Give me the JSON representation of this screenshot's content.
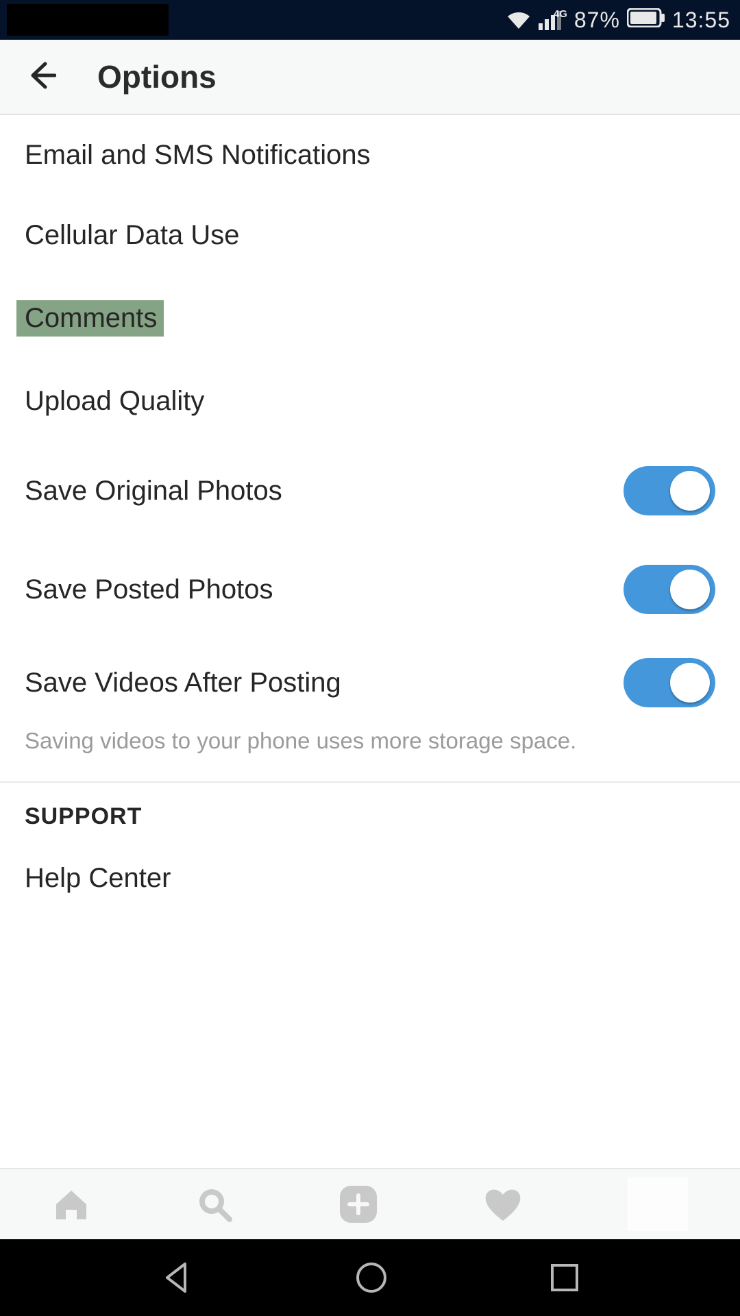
{
  "status": {
    "network_label": "4G",
    "battery_pct": "87%",
    "time": "13:55"
  },
  "header": {
    "title": "Options"
  },
  "options": {
    "email_sms": "Email and SMS Notifications",
    "cellular": "Cellular Data Use",
    "comments": "Comments",
    "upload_quality": "Upload Quality",
    "save_original": "Save Original Photos",
    "save_posted": "Save Posted Photos",
    "save_videos": "Save Videos After Posting",
    "save_videos_hint": "Saving videos to your phone uses more storage space.",
    "toggles": {
      "save_original": true,
      "save_posted": true,
      "save_videos": true
    }
  },
  "support": {
    "section": "SUPPORT",
    "help_center": "Help Center"
  }
}
